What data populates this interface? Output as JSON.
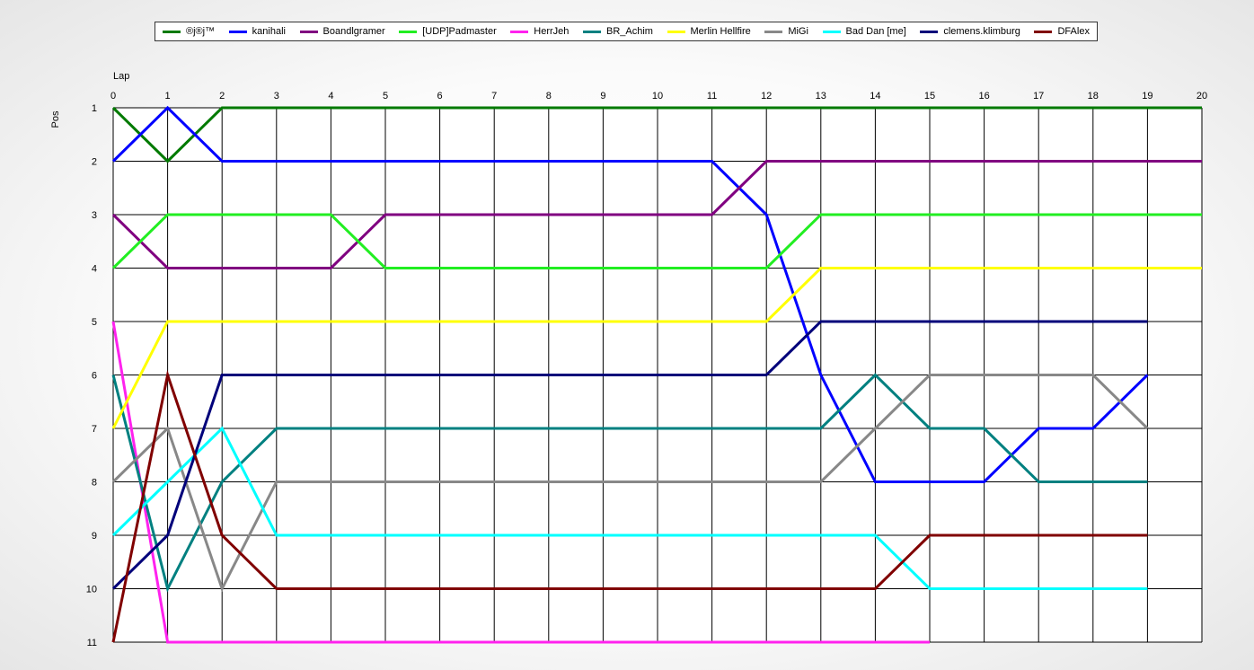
{
  "chart_data": {
    "type": "line",
    "xlabel": "Lap",
    "ylabel": "Pos",
    "xlim": [
      0,
      20
    ],
    "ylim": [
      1,
      11
    ],
    "x_ticks": [
      0,
      1,
      2,
      3,
      4,
      5,
      6,
      7,
      8,
      9,
      10,
      11,
      12,
      13,
      14,
      15,
      16,
      17,
      18,
      19,
      20
    ],
    "y_ticks": [
      1,
      2,
      3,
      4,
      5,
      6,
      7,
      8,
      9,
      10,
      11
    ],
    "y_inverted": true,
    "grid": true,
    "legend_position": "top",
    "series": [
      {
        "name": "®j®j™",
        "color": "#007a00",
        "x": [
          0,
          1,
          2,
          3,
          4,
          5,
          6,
          7,
          8,
          9,
          10,
          11,
          12,
          13,
          14,
          15,
          16,
          17,
          18,
          19,
          20
        ],
        "y": [
          1,
          2,
          1,
          1,
          1,
          1,
          1,
          1,
          1,
          1,
          1,
          1,
          1,
          1,
          1,
          1,
          1,
          1,
          1,
          1,
          1
        ]
      },
      {
        "name": "kanihali",
        "color": "#0000ff",
        "x": [
          0,
          1,
          2,
          3,
          4,
          5,
          6,
          7,
          8,
          9,
          10,
          11,
          12,
          13,
          14,
          15,
          16,
          17,
          18,
          19
        ],
        "y": [
          2,
          1,
          2,
          2,
          2,
          2,
          2,
          2,
          2,
          2,
          2,
          2,
          3,
          6,
          8,
          8,
          8,
          7,
          7,
          6
        ]
      },
      {
        "name": "Boandlgramer",
        "color": "#800080",
        "x": [
          0,
          1,
          2,
          3,
          4,
          5,
          6,
          7,
          8,
          9,
          10,
          11,
          12,
          13,
          14,
          15,
          16,
          17,
          18,
          19,
          20
        ],
        "y": [
          3,
          4,
          4,
          4,
          4,
          3,
          3,
          3,
          3,
          3,
          3,
          3,
          2,
          2,
          2,
          2,
          2,
          2,
          2,
          2,
          2
        ]
      },
      {
        "name": "[UDP]Padmaster",
        "color": "#22ee22",
        "x": [
          0,
          1,
          2,
          3,
          4,
          5,
          6,
          7,
          8,
          9,
          10,
          11,
          12,
          13,
          14,
          15,
          16,
          17,
          18,
          19,
          20
        ],
        "y": [
          4,
          3,
          3,
          3,
          3,
          4,
          4,
          4,
          4,
          4,
          4,
          4,
          4,
          3,
          3,
          3,
          3,
          3,
          3,
          3,
          3
        ]
      },
      {
        "name": "HerrJeh",
        "color": "#ff22ee",
        "x": [
          0,
          1,
          2,
          3,
          4,
          5,
          6,
          7,
          8,
          9,
          10,
          11,
          12,
          13,
          14,
          15
        ],
        "y": [
          5,
          11,
          11,
          11,
          11,
          11,
          11,
          11,
          11,
          11,
          11,
          11,
          11,
          11,
          11,
          11
        ]
      },
      {
        "name": "BR_Achim",
        "color": "#008080",
        "x": [
          0,
          1,
          2,
          3,
          4,
          5,
          6,
          7,
          8,
          9,
          10,
          11,
          12,
          13,
          14,
          15,
          16,
          17,
          18,
          19
        ],
        "y": [
          6,
          10,
          8,
          7,
          7,
          7,
          7,
          7,
          7,
          7,
          7,
          7,
          7,
          7,
          6,
          7,
          7,
          8,
          8,
          8
        ]
      },
      {
        "name": "Merlin Hellfire",
        "color": "#ffff00",
        "x": [
          0,
          1,
          2,
          3,
          4,
          5,
          6,
          7,
          8,
          9,
          10,
          11,
          12,
          13,
          14,
          15,
          16,
          17,
          18,
          19,
          20
        ],
        "y": [
          7,
          5,
          5,
          5,
          5,
          5,
          5,
          5,
          5,
          5,
          5,
          5,
          5,
          4,
          4,
          4,
          4,
          4,
          4,
          4,
          4
        ]
      },
      {
        "name": "MiGi",
        "color": "#888888",
        "x": [
          0,
          1,
          2,
          3,
          4,
          5,
          6,
          7,
          8,
          9,
          10,
          11,
          12,
          13,
          14,
          15,
          16,
          17,
          18,
          19
        ],
        "y": [
          8,
          7,
          10,
          8,
          8,
          8,
          8,
          8,
          8,
          8,
          8,
          8,
          8,
          8,
          7,
          6,
          6,
          6,
          6,
          7
        ]
      },
      {
        "name": "Bad Dan [me]",
        "color": "#00ffff",
        "x": [
          0,
          1,
          2,
          3,
          4,
          5,
          6,
          7,
          8,
          9,
          10,
          11,
          12,
          13,
          14,
          15,
          16,
          17,
          18,
          19
        ],
        "y": [
          9,
          8,
          7,
          9,
          9,
          9,
          9,
          9,
          9,
          9,
          9,
          9,
          9,
          9,
          9,
          10,
          10,
          10,
          10,
          10
        ]
      },
      {
        "name": "clemens.klimburg",
        "color": "#00007a",
        "x": [
          0,
          1,
          2,
          3,
          4,
          5,
          6,
          7,
          8,
          9,
          10,
          11,
          12,
          13,
          14,
          15,
          16,
          17,
          18,
          19
        ],
        "y": [
          10,
          9,
          6,
          6,
          6,
          6,
          6,
          6,
          6,
          6,
          6,
          6,
          6,
          5,
          5,
          5,
          5,
          5,
          5,
          5
        ]
      },
      {
        "name": "DFAlex",
        "color": "#800000",
        "x": [
          0,
          1,
          2,
          3,
          4,
          5,
          6,
          7,
          8,
          9,
          10,
          11,
          12,
          13,
          14,
          15,
          16,
          17,
          18,
          19
        ],
        "y": [
          11,
          6,
          9,
          10,
          10,
          10,
          10,
          10,
          10,
          10,
          10,
          10,
          10,
          10,
          10,
          9,
          9,
          9,
          9,
          9
        ]
      }
    ]
  }
}
